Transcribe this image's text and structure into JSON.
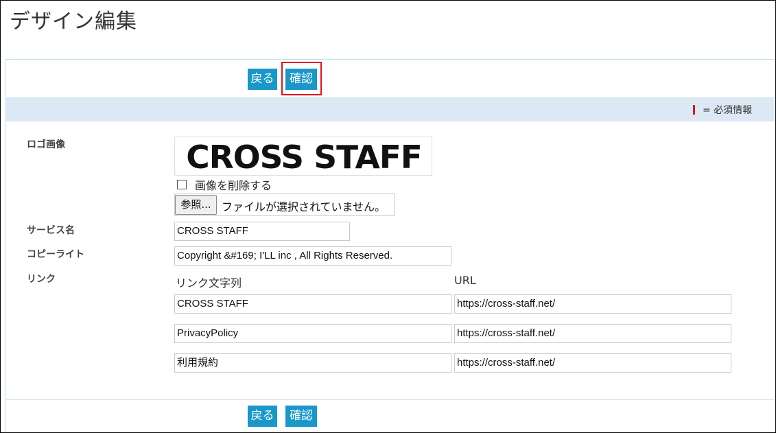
{
  "page": {
    "title": "デザイン編集"
  },
  "toolbar": {
    "back_label": "戻る",
    "confirm_label": "確認"
  },
  "required_note": {
    "text": "= 必須情報",
    "mark_color": "#e0141e"
  },
  "logo": {
    "label": "ロゴ画像",
    "image_text": "CROSS STAFF",
    "delete_label": "画像を削除する",
    "browse_label": "参照...",
    "file_status": "ファイルが選択されていません。"
  },
  "service": {
    "label": "サービス名",
    "value": "CROSS STAFF"
  },
  "copyright": {
    "label": "コピーライト",
    "value": "Copyright &#169; I'LL inc , All Rights Reserved."
  },
  "links": {
    "label": "リンク",
    "col_text": "リンク文字列",
    "col_url": "URL",
    "rows": [
      {
        "text": "CROSS STAFF",
        "url": "https://cross-staff.net/"
      },
      {
        "text": "PrivacyPolicy",
        "url": "https://cross-staff.net/"
      },
      {
        "text": "利用規約",
        "url": "https://cross-staff.net/"
      }
    ]
  },
  "colors": {
    "button": "#1a97c9",
    "highlight": "#e0141e",
    "required_bar": "#dce9f5"
  }
}
